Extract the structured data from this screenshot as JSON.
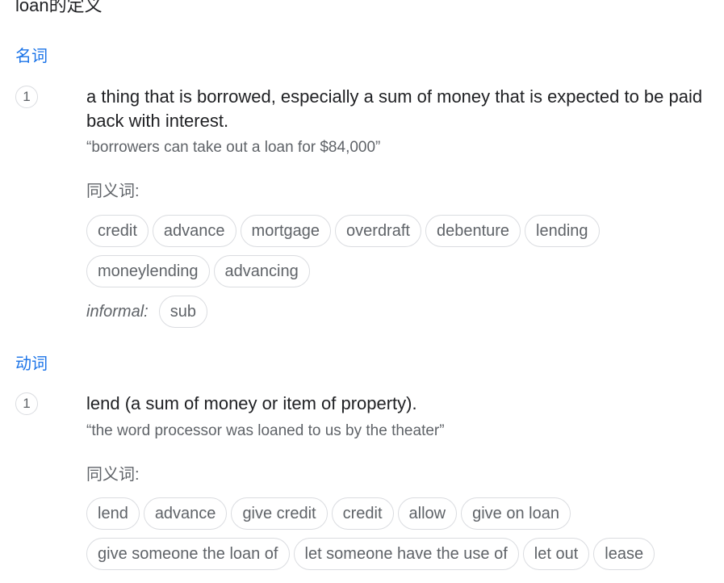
{
  "title": "loan的定义",
  "entries": [
    {
      "pos": "名词",
      "number": "1",
      "definition": "a thing that is borrowed, especially a sum of money that is expected to be paid back with interest.",
      "example": "“borrowers can take out a loan for $84,000”",
      "synonyms_label": "同义词:",
      "synonyms": [
        "credit",
        "advance",
        "mortgage",
        "overdraft",
        "debenture",
        "lending",
        "moneylending",
        "advancing"
      ],
      "informal_label": "informal:",
      "informal_synonyms": [
        "sub"
      ]
    },
    {
      "pos": "动词",
      "number": "1",
      "definition": "lend (a sum of money or item of property).",
      "example": "“the word processor was loaned to us by the theater”",
      "synonyms_label": "同义词:",
      "synonyms": [
        "lend",
        "advance",
        "give credit",
        "credit",
        "allow",
        "give on loan",
        "give someone the loan of",
        "let someone have the use of",
        "let out",
        "lease"
      ]
    }
  ]
}
